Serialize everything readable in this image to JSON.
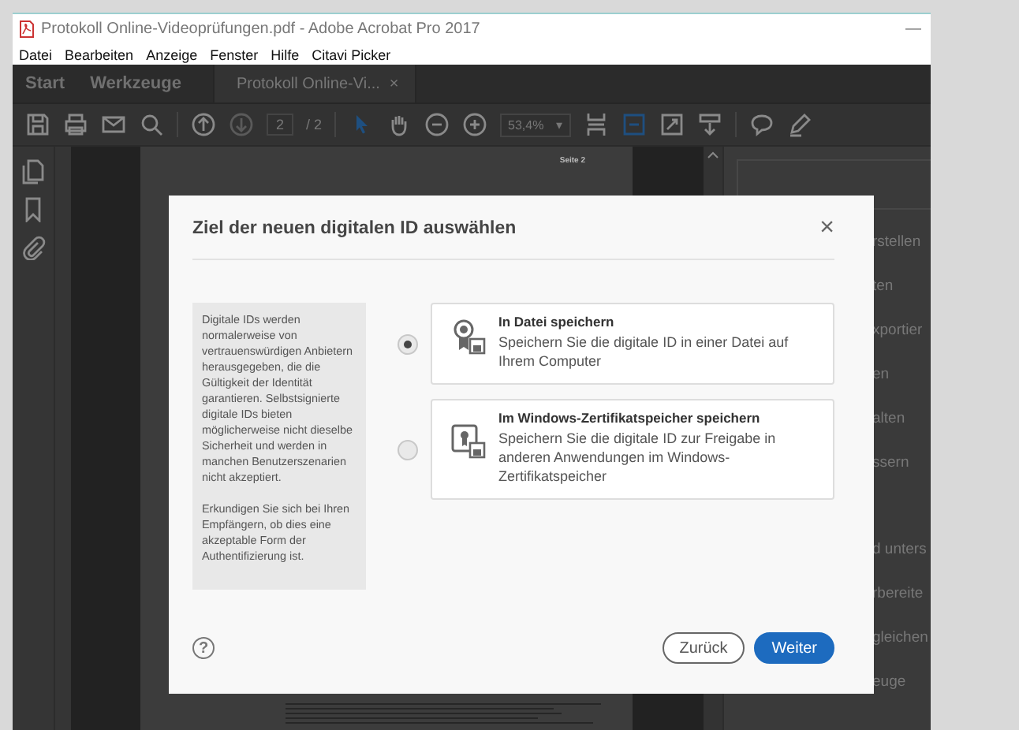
{
  "window": {
    "title": "Protokoll Online-Videoprüfungen.pdf - Adobe Acrobat Pro 2017",
    "minimize": "—"
  },
  "menu": [
    "Datei",
    "Bearbeiten",
    "Anzeige",
    "Fenster",
    "Hilfe",
    "Citavi Picker"
  ],
  "tabs": [
    {
      "label": "Start",
      "selected": false
    },
    {
      "label": "Werkzeuge",
      "selected": false
    },
    {
      "label": "Protokoll Online-Vi...",
      "selected": true,
      "close": "×"
    }
  ],
  "toolbar": {
    "page": "2",
    "page_total": "/ 2",
    "zoom": "53,4%",
    "zoom_caret": "▾"
  },
  "document": {
    "page_label": "Seite 2"
  },
  "right_panel": {
    "items": [
      {
        "label": "rstellen",
        "section_start": false
      },
      {
        "label": "ten",
        "section_start": false
      },
      {
        "label": "xportier",
        "section_start": false
      },
      {
        "label": "en",
        "section_start": false
      },
      {
        "label": "alten",
        "section_start": false
      },
      {
        "label": "ssern",
        "section_start": false
      },
      {
        "label": "d unters",
        "section_start": true
      },
      {
        "label": "rbereite",
        "section_start": false
      },
      {
        "label": "gleichen",
        "section_start": false
      },
      {
        "label": "euge",
        "section_start": false
      }
    ]
  },
  "dialog": {
    "title": "Ziel der neuen digitalen ID auswählen",
    "close": "×",
    "info": [
      "Digitale IDs werden normalerweise von vertrauenswürdigen Anbietern herausgegeben, die die Gültigkeit der Identität garantieren. Selbstsignierte digitale IDs bieten möglicherweise nicht dieselbe Sicherheit und werden in manchen Benutzerszenarien nicht akzeptiert.",
      "Erkundigen Sie sich bei Ihren Empfängern, ob dies eine akzeptable Form der Authentifizierung ist."
    ],
    "options": [
      {
        "title": "In Datei speichern",
        "description": "Speichern Sie die digitale ID in einer Datei auf Ihrem Computer",
        "selected": true
      },
      {
        "title": "Im Windows-Zertifikatspeicher speichern",
        "description": "Speichern Sie die digitale ID zur Freigabe in anderen Anwendungen im Windows-Zertifikatspeicher",
        "selected": false
      }
    ],
    "help": "?",
    "buttons": [
      {
        "label": "Zurück",
        "kind": "secondary"
      },
      {
        "label": "Weiter",
        "kind": "primary"
      }
    ]
  }
}
